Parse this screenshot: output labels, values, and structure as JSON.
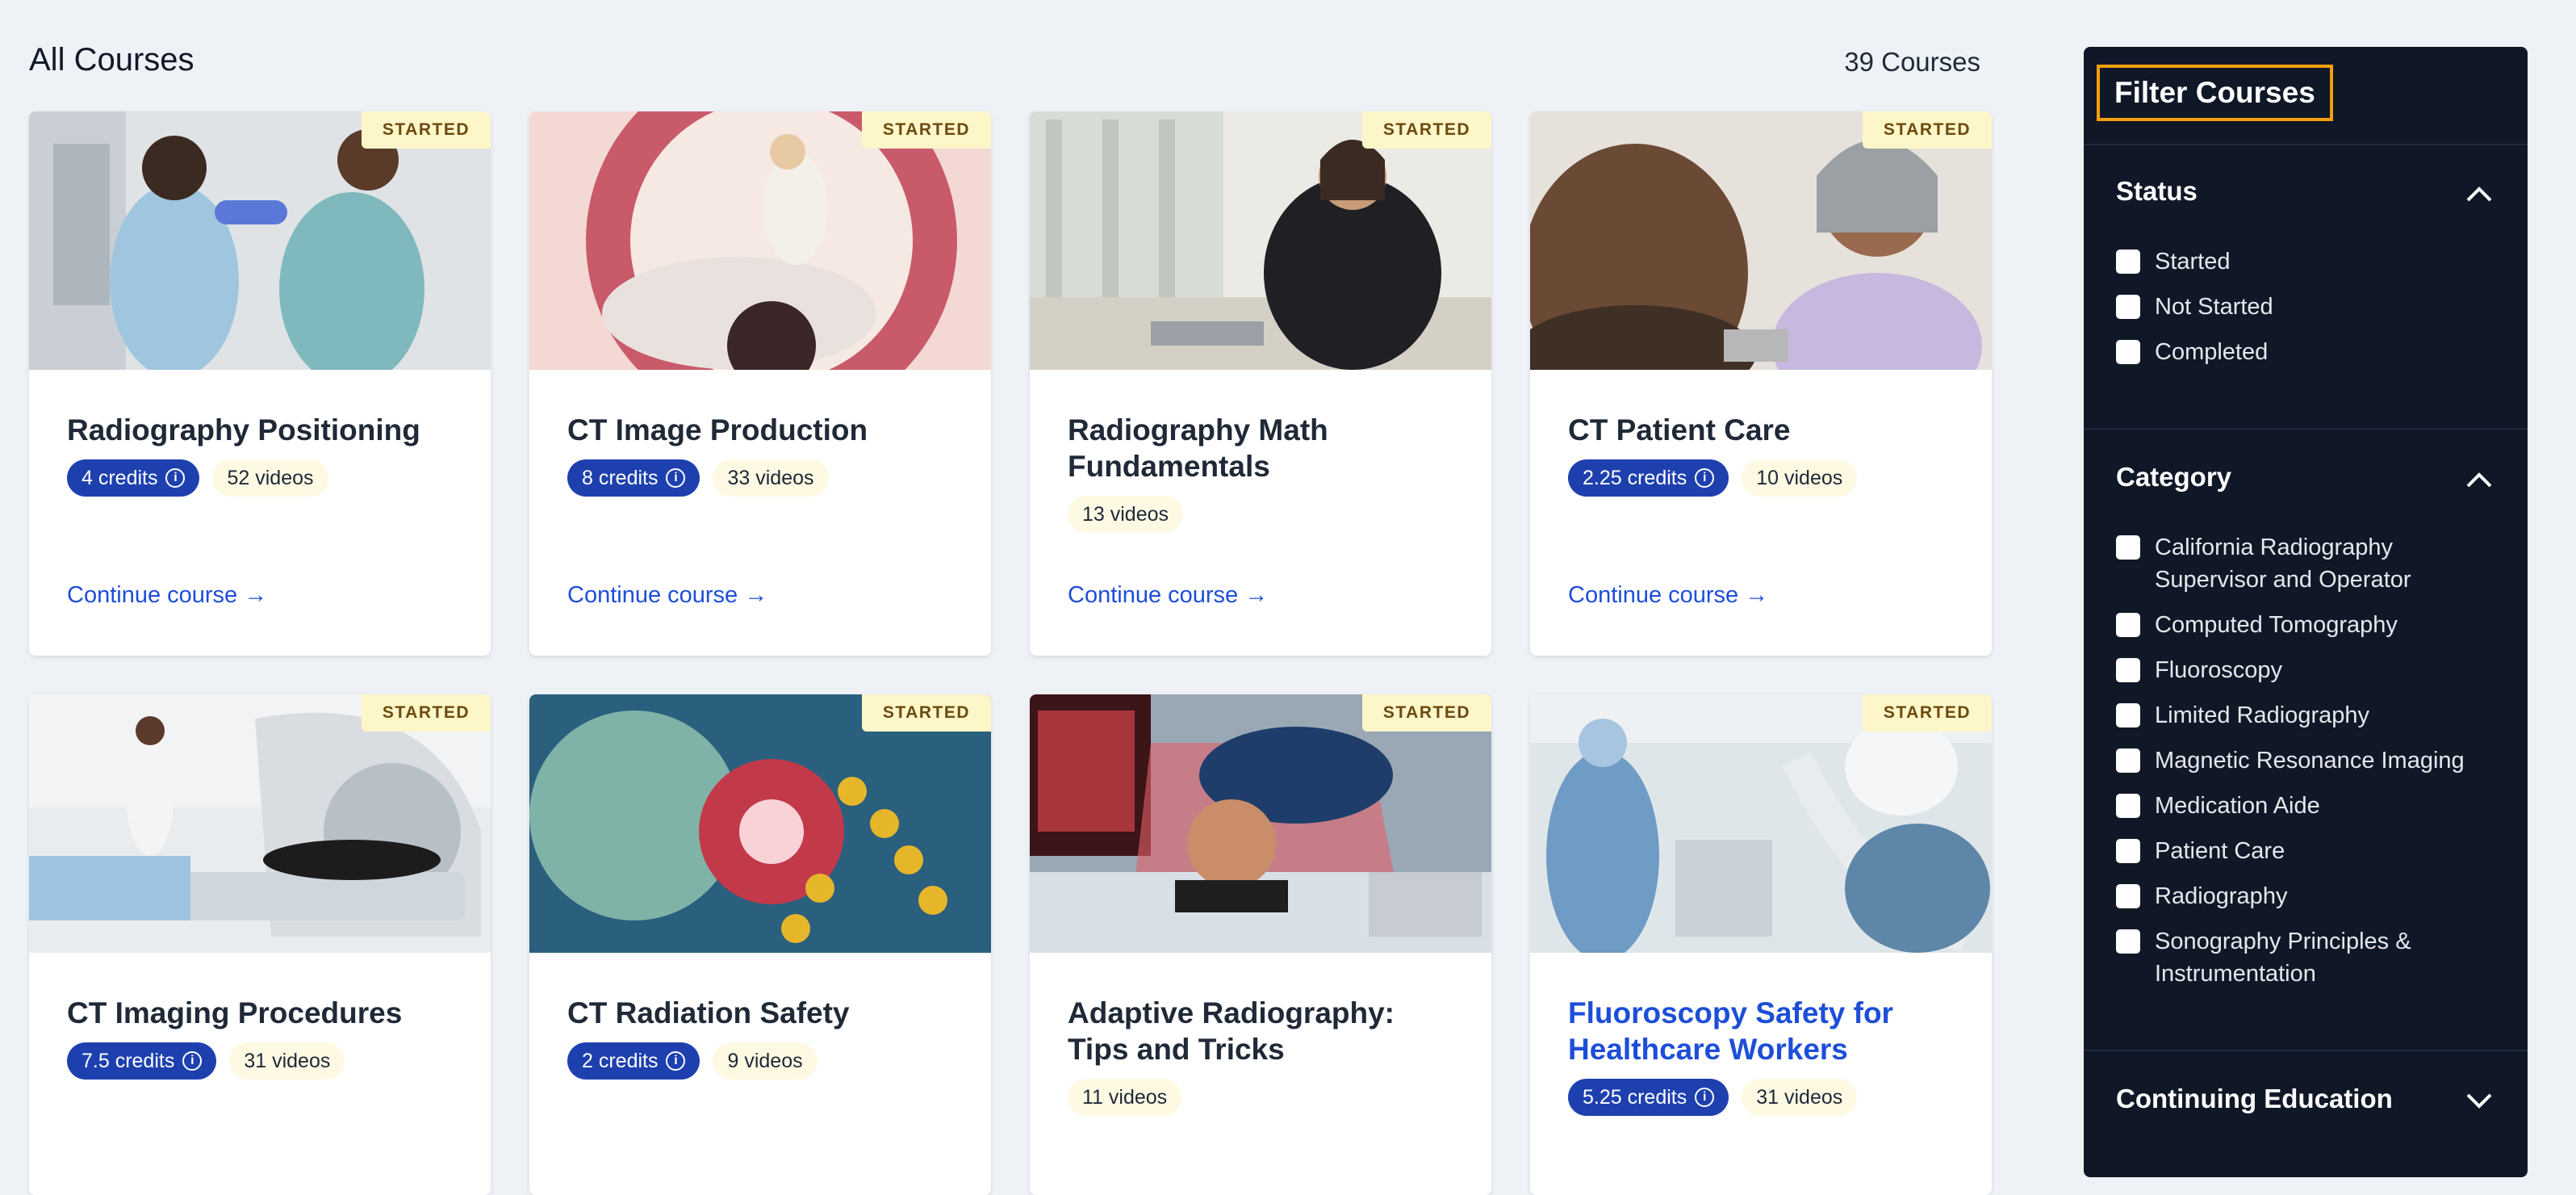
{
  "header": {
    "title": "All Courses",
    "count": "39 Courses"
  },
  "badge_started": "STARTED",
  "continue_label": "Continue course →",
  "courses": [
    {
      "title": "Radiography Positioning",
      "credits": "4 credits",
      "videos": "52 videos"
    },
    {
      "title": "CT Image Production",
      "credits": "8 credits",
      "videos": "33 videos"
    },
    {
      "title": "Radiography Math Fundamentals",
      "credits": "",
      "videos": "13 videos"
    },
    {
      "title": "CT Patient Care",
      "credits": "2.25 credits",
      "videos": "10 videos"
    },
    {
      "title": "CT Imaging Procedures",
      "credits": "7.5 credits",
      "videos": "31 videos"
    },
    {
      "title": "CT Radiation Safety",
      "credits": "2 credits",
      "videos": "9 videos"
    },
    {
      "title": "Adaptive Radiography: Tips and Tricks",
      "credits": "",
      "videos": "11 videos"
    },
    {
      "title": "Fluoroscopy Safety for Healthcare Workers",
      "credits": "5.25 credits",
      "videos": "31 videos"
    }
  ],
  "filter": {
    "title": "Filter Courses",
    "status": {
      "heading": "Status",
      "options": [
        "Started",
        "Not Started",
        "Completed"
      ]
    },
    "category": {
      "heading": "Category",
      "options": [
        "California Radiography Supervisor and Operator",
        "Computed Tomography",
        "Fluoroscopy",
        "Limited Radiography",
        "Magnetic Resonance Imaging",
        "Medication Aide",
        "Patient Care",
        "Radiography",
        "Sonography Principles & Instrumentation"
      ]
    },
    "continuing": {
      "heading": "Continuing Education"
    }
  },
  "colors": {
    "accent": "#1d4ed8",
    "credit_pill": "#1e40af",
    "badge_bg": "#fdf6c9",
    "sidebar_bg": "#101828"
  }
}
